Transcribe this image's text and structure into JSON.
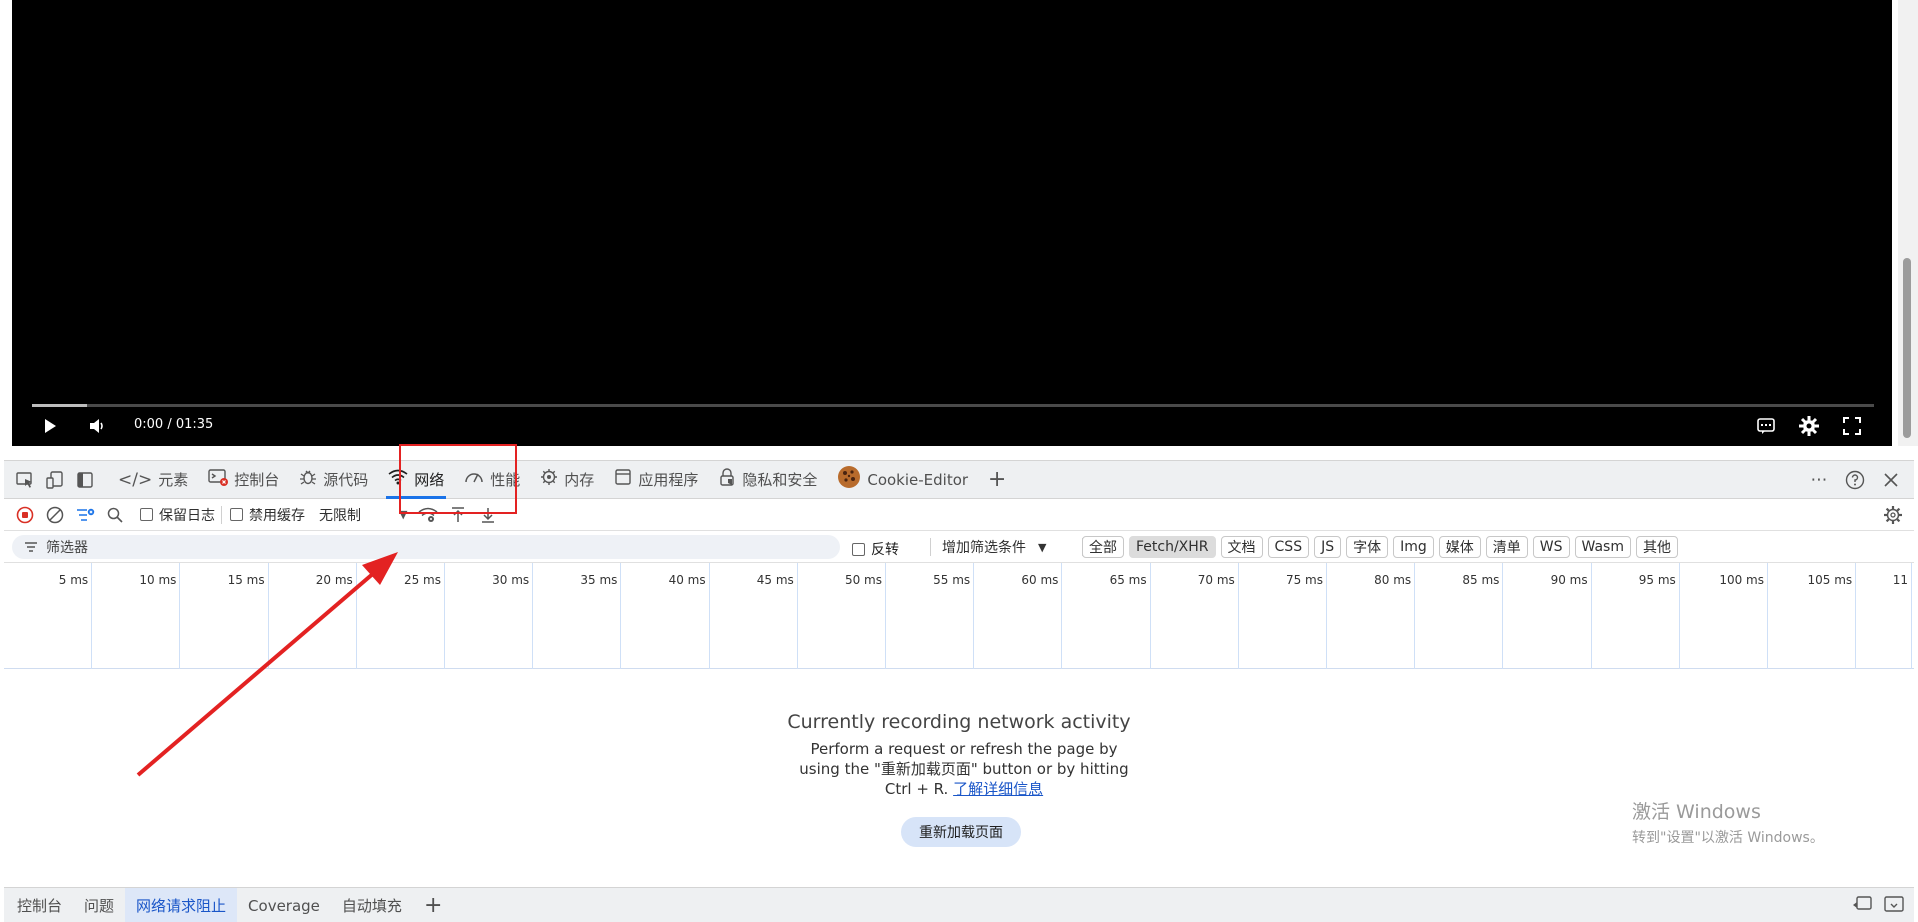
{
  "video": {
    "time": "0:00 / 01:35",
    "progress": 0.03
  },
  "devtools": {
    "tabs": [
      {
        "label": "元素",
        "icon": "code-icon"
      },
      {
        "label": "控制台",
        "icon": "console-icon"
      },
      {
        "label": "源代码",
        "icon": "bug-icon"
      },
      {
        "label": "网络",
        "icon": "wifi-icon",
        "active": true
      },
      {
        "label": "性能",
        "icon": "gauge-icon"
      },
      {
        "label": "内存",
        "icon": "chip-icon"
      },
      {
        "label": "应用程序",
        "icon": "window-icon"
      },
      {
        "label": "隐私和安全",
        "icon": "lock-icon"
      },
      {
        "label": "Cookie-Editor",
        "icon": "cookie-icon"
      }
    ],
    "toolbar": {
      "preserve_log": "保留日志",
      "disable_cache": "禁用缓存",
      "throttling": "无限制"
    },
    "filter": {
      "placeholder": "筛选器",
      "invert": "反转",
      "more_filters": "增加筛选条件",
      "types": [
        "全部",
        "Fetch/XHR",
        "文档",
        "CSS",
        "JS",
        "字体",
        "Img",
        "媒体",
        "清单",
        "WS",
        "Wasm",
        "其他"
      ],
      "active_type": "Fetch/XHR"
    },
    "timeline_ticks": [
      "5 ms",
      "10 ms",
      "15 ms",
      "20 ms",
      "25 ms",
      "30 ms",
      "35 ms",
      "40 ms",
      "45 ms",
      "50 ms",
      "55 ms",
      "60 ms",
      "65 ms",
      "70 ms",
      "75 ms",
      "80 ms",
      "85 ms",
      "90 ms",
      "95 ms",
      "100 ms",
      "105 ms",
      "11"
    ],
    "empty_state": {
      "title": "Currently recording network activity",
      "desc_1": "Perform a request or refresh the page by using the \"重新加载页面\" button or by hitting Ctrl + R.",
      "learn_more": "了解详细信息",
      "reload_button": "重新加载页面"
    },
    "watermark": {
      "line1": "激活 Windows",
      "line2": "转到\"设置\"以激活 Windows。"
    },
    "drawer_tabs": [
      {
        "label": "控制台"
      },
      {
        "label": "问题"
      },
      {
        "label": "网络请求阻止",
        "active": true
      },
      {
        "label": "Coverage"
      },
      {
        "label": "自动填充"
      }
    ]
  },
  "colors": {
    "accent": "#1a73e8",
    "annotation": "#e32222"
  }
}
